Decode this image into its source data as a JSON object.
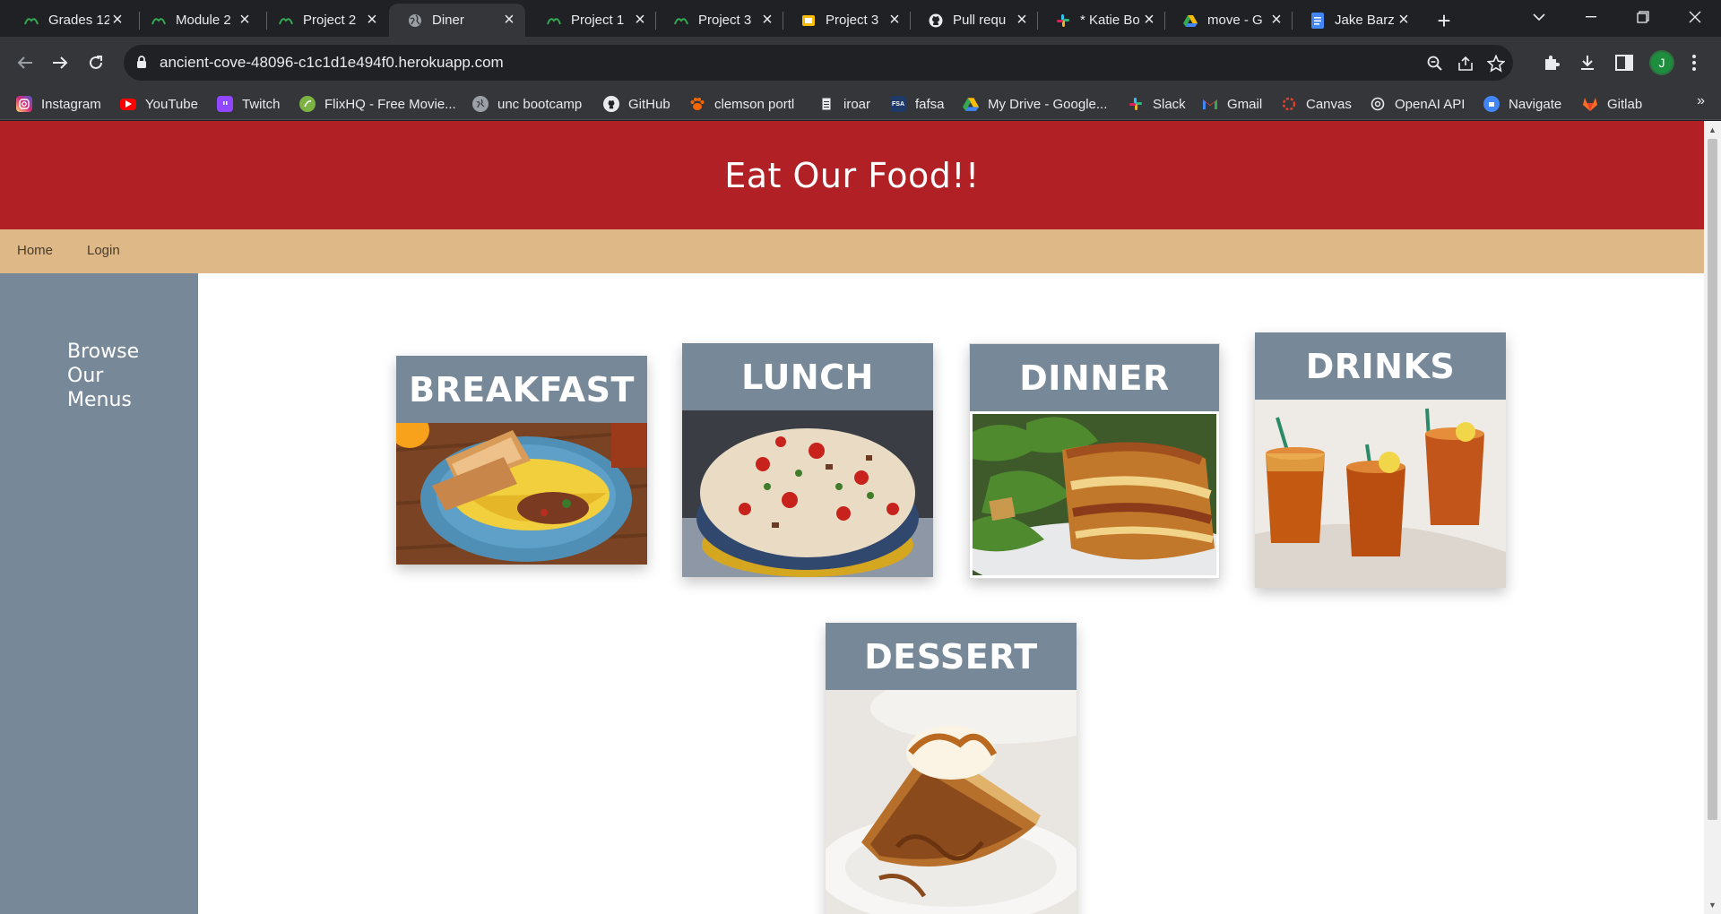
{
  "browser": {
    "tabs": [
      {
        "title": "Grades 12",
        "favicon": "bootcamp-leaf-icon",
        "active": false
      },
      {
        "title": "Module 2",
        "favicon": "bootcamp-leaf-icon",
        "active": false
      },
      {
        "title": "Project 2",
        "favicon": "bootcamp-leaf-icon",
        "active": false
      },
      {
        "title": "Diner",
        "favicon": "globe-icon",
        "active": true
      },
      {
        "title": "Project 1",
        "favicon": "bootcamp-leaf-icon",
        "active": false
      },
      {
        "title": "Project 3",
        "favicon": "bootcamp-leaf-icon",
        "active": false
      },
      {
        "title": "Project 3",
        "favicon": "slides-icon",
        "active": false
      },
      {
        "title": "Pull requ",
        "favicon": "github-icon",
        "active": false
      },
      {
        "title": "* Katie Bo",
        "favicon": "slack-icon",
        "active": false
      },
      {
        "title": "move - G",
        "favicon": "drive-icon",
        "active": false
      },
      {
        "title": "Jake Barz",
        "favicon": "docs-icon",
        "active": false
      }
    ],
    "url": "ancient-cove-48096-c1c1d1e494f0.herokuapp.com",
    "profile_initial": "J",
    "bookmarks": [
      {
        "label": "Instagram",
        "icon": "instagram-icon",
        "color": "#d6249f"
      },
      {
        "label": "YouTube",
        "icon": "youtube-icon",
        "color": "#ff0000"
      },
      {
        "label": "Twitch",
        "icon": "twitch-icon",
        "color": "#9146ff"
      },
      {
        "label": "FlixHQ - Free Movie...",
        "icon": "flixhq-icon",
        "color": "#7cb342"
      },
      {
        "label": "unc bootcamp",
        "icon": "globe-icon",
        "color": "#5f6368"
      },
      {
        "label": "GitHub",
        "icon": "github-icon",
        "color": "#e8eaed"
      },
      {
        "label": "clemson portl",
        "icon": "clemson-paw-icon",
        "color": "#f56600"
      },
      {
        "label": "iroar",
        "icon": "document-icon",
        "color": "#e8eaed"
      },
      {
        "label": "fafsa",
        "icon": "fafsa-icon",
        "color": "#1f3a68"
      },
      {
        "label": "My Drive - Google...",
        "icon": "drive-icon",
        "color": "#fbbc04"
      },
      {
        "label": "Slack",
        "icon": "slack-icon",
        "color": "#e01e5a"
      },
      {
        "label": "Gmail",
        "icon": "gmail-icon",
        "color": "#ea4335"
      },
      {
        "label": "Canvas",
        "icon": "canvas-icon",
        "color": "#e4412b"
      },
      {
        "label": "OpenAI API",
        "icon": "openai-icon",
        "color": "#e8eaed"
      },
      {
        "label": "Navigate",
        "icon": "navigate-icon",
        "color": "#4285f4"
      },
      {
        "label": "Gitlab",
        "icon": "gitlab-icon",
        "color": "#fc6d26"
      }
    ],
    "bookmarks_more": "»"
  },
  "page": {
    "title": "Eat Our Food!!",
    "nav": [
      "Home",
      "Login"
    ],
    "sidebar_text": "Browse Our Menus",
    "menus": [
      {
        "label": "BREAKFAST",
        "image": "omelette-and-toast-photo"
      },
      {
        "label": "LUNCH",
        "image": "pasta-salad-photo"
      },
      {
        "label": "DINNER",
        "image": "lasagna-and-caesar-salad-photo"
      },
      {
        "label": "DRINKS",
        "image": "iced-tea-glasses-photo"
      },
      {
        "label": "DESSERT",
        "image": "apple-pie-with-ice-cream-photo"
      }
    ]
  },
  "colors": {
    "header_red": "#b12024",
    "nav_tan": "#deb887",
    "slate_gray": "#778899"
  }
}
